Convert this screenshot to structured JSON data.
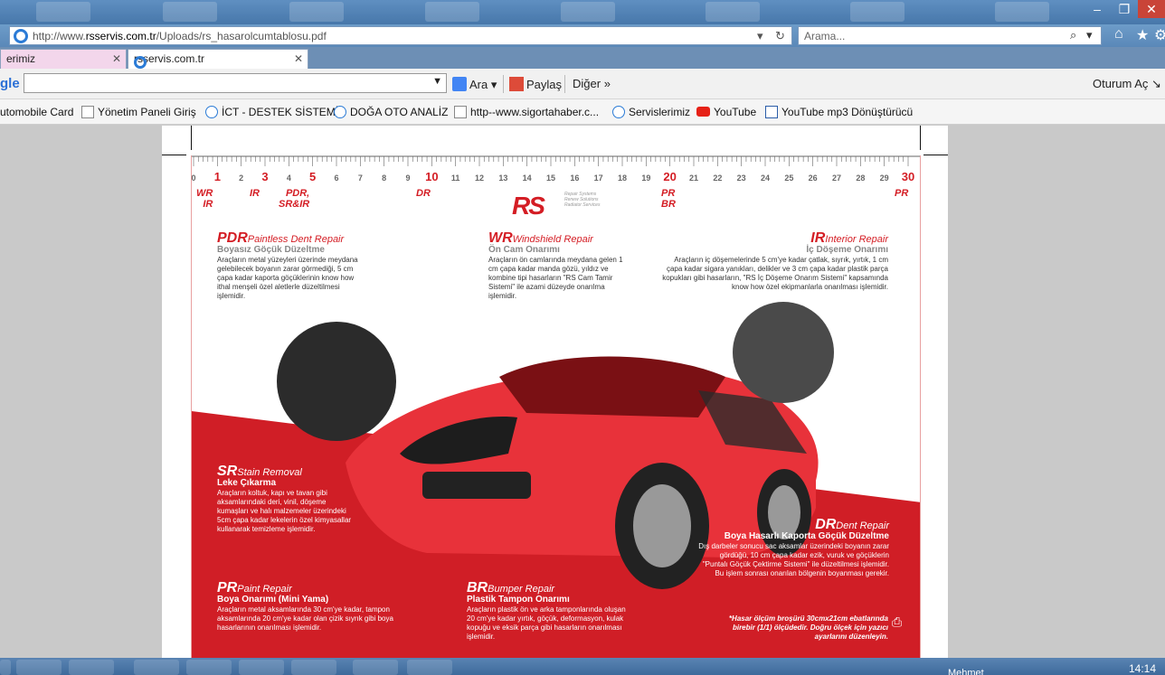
{
  "browser": {
    "url_prefix": "http://www.",
    "url_domain": "rsservis.com.tr",
    "url_path": "/Uploads/rs_hasarolcumtablosu.pdf",
    "search_placeholder": "Arama...",
    "tabs": [
      {
        "label": "erimiz"
      },
      {
        "label": "rsservis.com.tr"
      }
    ]
  },
  "toolbar": {
    "google_logo": "gle",
    "ara": "Ara",
    "paylas": "Paylaş",
    "diger": "Diğer",
    "oturum": "Oturum Aç"
  },
  "favorites": [
    {
      "label": "utomobile Card"
    },
    {
      "label": "Yönetim Paneli  Giriş"
    },
    {
      "label": "İCT - DESTEK SİSTEMİ"
    },
    {
      "label": "DOĞA OTO ANALİZ"
    },
    {
      "label": "http--www.sigortahaber.c..."
    },
    {
      "label": "Servislerimiz"
    },
    {
      "label": "YouTube"
    },
    {
      "label": "YouTube mp3 Dönüştürücü"
    }
  ],
  "ruler": {
    "labels": [
      "0",
      "1",
      "2",
      "3",
      "4",
      "5",
      "6",
      "7",
      "8",
      "9",
      "10",
      "11",
      "12",
      "13",
      "14",
      "15",
      "16",
      "17",
      "18",
      "19",
      "20",
      "21",
      "22",
      "23",
      "24",
      "25",
      "26",
      "27",
      "28",
      "29",
      "30"
    ],
    "highlight": [
      "1",
      "3",
      "5",
      "10",
      "20",
      "30"
    ]
  },
  "markers": {
    "wr_ir": "WR\nIR",
    "ir": "IR",
    "pdr": "PDR,\nSR&IR",
    "dr": "DR",
    "pr_br": "PR\nBR",
    "pr": "PR"
  },
  "logo": {
    "rs": "RS",
    "sub": "Repair Systems\nRenew Solutions\nRadiator Services"
  },
  "services": {
    "pdr": {
      "code": "PDR",
      "eng": "Paintless Dent Repair",
      "tr": "Boyasız Göçük Düzeltme",
      "body": "Araçların metal yüzeyleri üzerinde meydana gelebilecek boyanın zarar görmediği, 5 cm çapa kadar kaporta göçüklerinin know how ithal menşeli özel aletlerle düzeltilmesi işlemidir."
    },
    "wr": {
      "code": "WR",
      "eng": "Windshield Repair",
      "tr": "Ön Cam Onarımı",
      "body": "Araçların ön camlarında meydana gelen 1 cm çapa kadar manda gözü, yıldız ve kombine tipi hasarların \"RS Cam Tamir Sistemi\" ile azami düzeyde onarılma işlemidir."
    },
    "ir": {
      "code": "IR",
      "eng": "Interior Repair",
      "tr": "İç Döşeme Onarımı",
      "body": "Araçların iç döşemelerinde 5 cm'ye kadar çatlak, sıyrık, yırtık, 1 cm çapa kadar sigara yanıkları, delikler ve 3 cm çapa kadar plastik parça kopukları gibi hasarların, \"RS İç Döşeme Onarım Sistemi\" kapsamında know how özel ekipmanlarla onarılması işlemidir."
    },
    "sr": {
      "code": "SR",
      "eng": "Stain Removal",
      "tr": "Leke Çıkarma",
      "body": "Araçların koltuk, kapı ve tavan gibi aksamlarındaki deri, vinil, döşeme kumaşları ve halı malzemeler üzerindeki 5cm çapa kadar lekelerin özel kimyasallar kullanarak temizleme işlemidir."
    },
    "dr": {
      "code": "DR",
      "eng": "Dent Repair",
      "tr": "Boya Hasarlı Kaporta Göçük Düzeltme",
      "body": "Dış darbeler sonucu sac aksamlar üzerindeki boyanın zarar gördüğü, 10 cm çapa kadar ezik, vuruk ve göçüklerin \"Puntalı Göçük Çektirme Sistemi\" ile düzeltilmesi işlemidir. Bu işlem sonrası onarılan bölgenin boyanması gerekir."
    },
    "pr": {
      "code": "PR",
      "eng": "Paint Repair",
      "tr": "Boya Onarımı (Mini Yama)",
      "body": "Araçların metal aksamlarında 30 cm'ye kadar, tampon aksamlarında 20 cm'ye kadar olan çizik sıyrık gibi boya hasarlarının onarılması işlemidir."
    },
    "br": {
      "code": "BR",
      "eng": "Bumper Repair",
      "tr": "Plastik Tampon Onarımı",
      "body": "Araçların plastik ön ve arka tamponlarında oluşan 20 cm'ye kadar yırtık, göçük, deformasyon, kulak kopuğu ve eksik parça gibi hasarların onarılması işlemidir."
    }
  },
  "note": "*Hasar ölçüm broşürü 30cmx21cm ebatlarında birebir (1/1) ölçüdedir. Doğru ölçek için yazıcı ayarlarını düzenleyin.",
  "taskbar": {
    "user": "Mehmet",
    "time": "14:14"
  },
  "colors": {
    "brand_red": "#d41d24",
    "titlebar_blue": "#4f7fb0"
  }
}
